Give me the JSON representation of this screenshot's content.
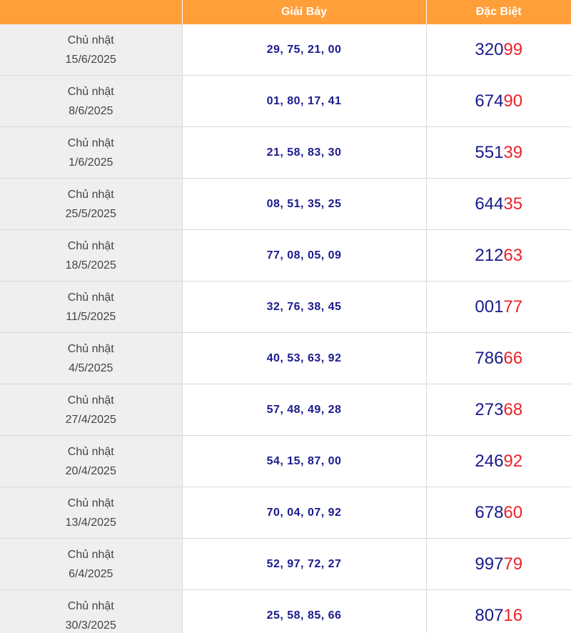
{
  "columns": {
    "date": "",
    "giai_bay": "Giải Bảy",
    "dac_biet": "Đặc Biệt"
  },
  "rows": [
    {
      "weekday": "Chủ nhật",
      "date": "15/6/2025",
      "giai_bay": "29, 75, 21, 00",
      "db_head": "320",
      "db_tail": "99"
    },
    {
      "weekday": "Chủ nhật",
      "date": "8/6/2025",
      "giai_bay": "01, 80, 17, 41",
      "db_head": "674",
      "db_tail": "90"
    },
    {
      "weekday": "Chủ nhật",
      "date": "1/6/2025",
      "giai_bay": "21, 58, 83, 30",
      "db_head": "551",
      "db_tail": "39"
    },
    {
      "weekday": "Chủ nhật",
      "date": "25/5/2025",
      "giai_bay": "08, 51, 35, 25",
      "db_head": "644",
      "db_tail": "35"
    },
    {
      "weekday": "Chủ nhật",
      "date": "18/5/2025",
      "giai_bay": "77, 08, 05, 09",
      "db_head": "212",
      "db_tail": "63"
    },
    {
      "weekday": "Chủ nhật",
      "date": "11/5/2025",
      "giai_bay": "32, 76, 38, 45",
      "db_head": "001",
      "db_tail": "77"
    },
    {
      "weekday": "Chủ nhật",
      "date": "4/5/2025",
      "giai_bay": "40, 53, 63, 92",
      "db_head": "786",
      "db_tail": "66"
    },
    {
      "weekday": "Chủ nhật",
      "date": "27/4/2025",
      "giai_bay": "57, 48, 49, 28",
      "db_head": "273",
      "db_tail": "68"
    },
    {
      "weekday": "Chủ nhật",
      "date": "20/4/2025",
      "giai_bay": "54, 15, 87, 00",
      "db_head": "246",
      "db_tail": "92"
    },
    {
      "weekday": "Chủ nhật",
      "date": "13/4/2025",
      "giai_bay": "70, 04, 07, 92",
      "db_head": "678",
      "db_tail": "60"
    },
    {
      "weekday": "Chủ nhật",
      "date": "6/4/2025",
      "giai_bay": "52, 97, 72, 27",
      "db_head": "997",
      "db_tail": "79"
    },
    {
      "weekday": "Chủ nhật",
      "date": "30/3/2025",
      "giai_bay": "25, 58, 85, 66",
      "db_head": "807",
      "db_tail": "16"
    }
  ],
  "colors": {
    "header_bg": "#ff9f3a",
    "number_blue": "#1a1a8c",
    "highlight_red": "#e8242a",
    "date_cell_bg": "#efefef"
  }
}
